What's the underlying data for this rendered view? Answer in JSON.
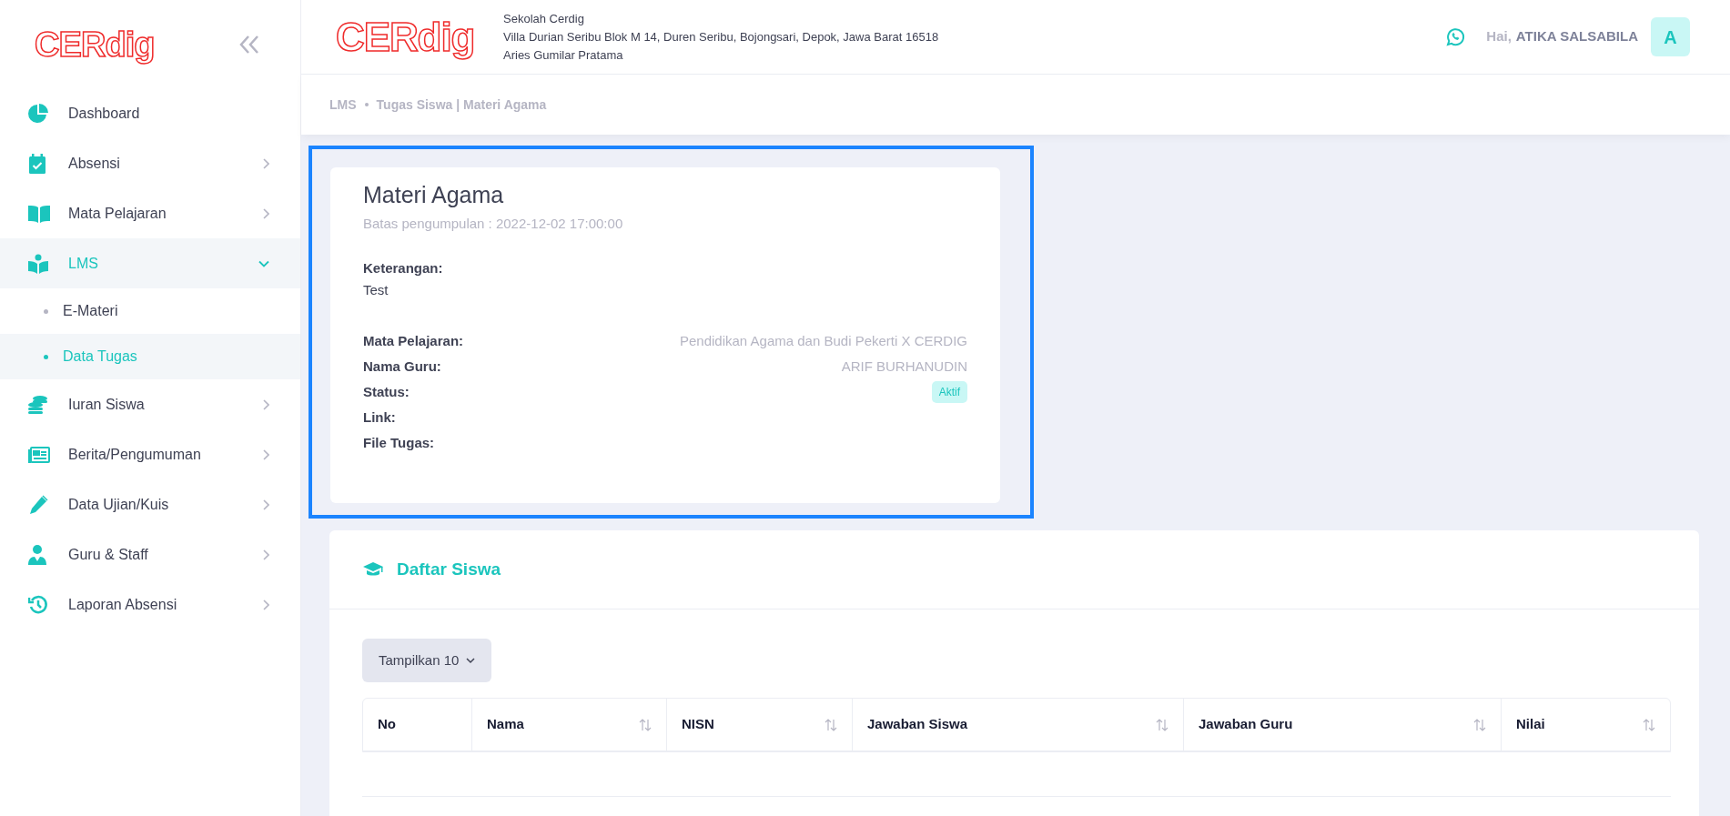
{
  "sidebar": {
    "logo": "CERdig",
    "items": [
      {
        "label": "Dashboard",
        "kind": "link",
        "selected": false
      },
      {
        "label": "Absensi",
        "kind": "group",
        "selected": false,
        "expanded": false
      },
      {
        "label": "Mata Pelajaran",
        "kind": "group",
        "selected": false,
        "expanded": false
      },
      {
        "label": "LMS",
        "kind": "group",
        "selected": true,
        "expanded": true,
        "children": [
          {
            "label": "E-Materi",
            "selected": false
          },
          {
            "label": "Data Tugas",
            "selected": true
          }
        ]
      },
      {
        "label": "Iuran Siswa",
        "kind": "group",
        "selected": false,
        "expanded": false
      },
      {
        "label": "Berita/Pengumuman",
        "kind": "group",
        "selected": false,
        "expanded": false
      },
      {
        "label": "Data Ujian/Kuis",
        "kind": "group",
        "selected": false,
        "expanded": false
      },
      {
        "label": "Guru & Staff",
        "kind": "group",
        "selected": false,
        "expanded": false
      },
      {
        "label": "Laporan Absensi",
        "kind": "group",
        "selected": false,
        "expanded": false
      }
    ]
  },
  "header": {
    "logo": "CERdig",
    "school_lines": [
      "Sekolah Cerdig",
      "Villa Durian Seribu Blok M 14, Duren Seribu, Bojongsari, Depok, Jawa Barat 16518",
      "Aries Gumilar Pratama"
    ],
    "greeting": "Hai,",
    "user_name": "ATIKA SALSABILA",
    "avatar_letter": "A"
  },
  "breadcrumb": [
    "LMS",
    "Tugas Siswa | Materi Agama"
  ],
  "task": {
    "title": "Materi Agama",
    "deadline": "Batas pengumpulan : 2022-12-02 17:00:00",
    "description_label": "Keterangan:",
    "description": "Test",
    "fields": [
      {
        "label": "Mata Pelajaran:",
        "kind": "text",
        "value": "Pendidikan Agama dan Budi Pekerti X CERDIG"
      },
      {
        "label": "Nama Guru:",
        "kind": "text",
        "value": "ARIF BURHANUDIN"
      },
      {
        "label": "Status:",
        "kind": "badge",
        "value": "Aktif"
      },
      {
        "label": "Link:"
      },
      {
        "label": "File Tugas:"
      }
    ]
  },
  "students": {
    "title": "Daftar Siswa",
    "page_size_button": "Tampilkan 10",
    "columns": [
      {
        "label": "No",
        "sortable": false
      },
      {
        "label": "Nama",
        "sortable": true
      },
      {
        "label": "NISN",
        "sortable": true
      },
      {
        "label": "Jawaban Siswa",
        "sortable": true
      },
      {
        "label": "Jawaban Guru",
        "sortable": true
      },
      {
        "label": "Nilai",
        "sortable": true
      }
    ]
  }
}
